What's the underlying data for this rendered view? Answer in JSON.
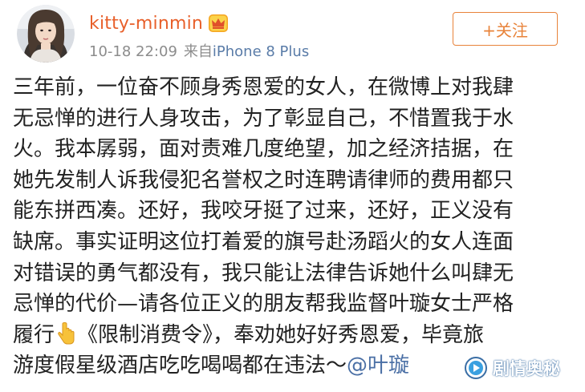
{
  "post": {
    "username": "kitty-minmin",
    "vip_icon": "crown-icon",
    "timestamp": "10-18 22:09",
    "source_prefix": "来自",
    "source_device": "iPhone 8 Plus",
    "follow_button": "+关注",
    "content_lines": [
      "三年前，一位奋不顾身秀恩爱的女人，在微博上对我肆",
      "无忌惮的进行人身攻击，为了彰显自己，不惜置我于水",
      "火。我本孱弱，面对责难几度绝望，加之经济拮据，在",
      "她先发制人诉我侵犯名誉权之时连聘请律师的费用都只",
      "能东拼西凑。还好，我咬牙挺了过来，还好，正义没有",
      "缺席。事实证明这位打着爱的旗号赴汤蹈火的女人连面",
      "对错误的勇气都没有，我只能让法律告诉她什么叫肆无",
      "忌惮的代价—请各位正义的朋友帮我监督叶璇女士严格"
    ],
    "line9_before_icon": "履行",
    "line9_after_icon": "《限制消费令》，奉劝她好好秀恩爱，毕竟旅",
    "line10_text": "游度假星级酒店吃吃喝喝都在违法～",
    "mention": "@叶璇",
    "pointing_icon": "pointing-down-hand-icon",
    "colors": {
      "username": "#e8602b",
      "meta": "#8c8c8c",
      "follow": "#e8833a",
      "mention": "#4a6fa5"
    }
  },
  "watermark": {
    "text": "剧情奥秘",
    "logo_icon": "play-logo-icon"
  }
}
